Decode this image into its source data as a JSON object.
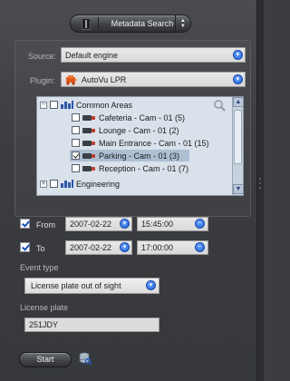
{
  "header": {
    "title": "Metadata Search"
  },
  "source": {
    "label": "Source:",
    "value": "Default engine"
  },
  "plugin": {
    "label": "Plugin:",
    "value": "AutoVu LPR"
  },
  "tree": {
    "root_label": "Common Areas",
    "items": [
      {
        "label": "Cafeteria - Cam - 01 (5)",
        "checked": false
      },
      {
        "label": "Lounge - Cam - 01 (2)",
        "checked": false
      },
      {
        "label": "Main Entrance - Cam - 01 (15)",
        "checked": false
      },
      {
        "label": "Parking - Cam - 01 (3)",
        "checked": true
      },
      {
        "label": "Reception - Cam - 01 (7)",
        "checked": false
      }
    ],
    "second_root_label": "Engineering"
  },
  "from": {
    "label": "From",
    "date": "2007-02-22",
    "time": "15:45:00",
    "checked": true
  },
  "to": {
    "label": "To",
    "date": "2007-02-22",
    "time": "17:00:00",
    "checked": true
  },
  "event_type": {
    "label": "Event type",
    "value": "License plate out of sight"
  },
  "license_plate": {
    "label": "License plate",
    "value": "251JDY"
  },
  "actions": {
    "start_label": "Start"
  },
  "colors": {
    "accent_blue": "#1f5fd6",
    "panel_bg": "#3b3d40"
  }
}
